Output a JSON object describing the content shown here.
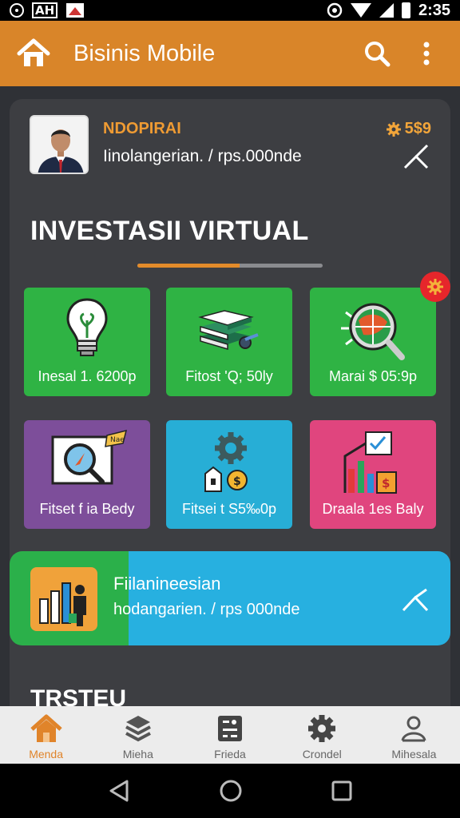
{
  "status_bar": {
    "box_text": "AH",
    "time": "2:35"
  },
  "app_bar": {
    "title": "Bisinis Mobile",
    "home_icon": "home-icon",
    "search_icon": "search-icon",
    "menu_icon": "more-vert-icon",
    "color": "#d98529"
  },
  "profile": {
    "name": "NDOPIRAI",
    "description": "Iinolangerian. / rps.000nde",
    "coins": "5$9"
  },
  "section": {
    "title": "INVESTASII VIRTUAL",
    "progress": 0.55
  },
  "tiles": [
    {
      "label": "Inesal 1. 6200p",
      "color": "#2fb344",
      "icon": "lightbulb-icon"
    },
    {
      "label": "Fitost 'Q; 50ly",
      "color": "#2fb344",
      "icon": "books-icon"
    },
    {
      "label": "Marai $ 05:9p",
      "color": "#2fb344",
      "icon": "globe-magnifier-icon"
    },
    {
      "label": "Fitset f ia Bedy",
      "color": "#7d4e9a",
      "icon": "screen-search-icon",
      "tag": "Nae"
    },
    {
      "label": "Fitsei t S5‰0p",
      "color": "#27aed6",
      "icon": "gear-money-icon"
    },
    {
      "label": "Draala 1es Baly",
      "color": "#e0457e",
      "icon": "chart-money-icon"
    }
  ],
  "banner": {
    "title": "Fiilanineesian",
    "description": "hodangarien. / rps 000nde"
  },
  "sub_section": {
    "title": "TRSTEU"
  },
  "bottom_nav": [
    {
      "label": "Menda",
      "icon": "home-icon",
      "active": true
    },
    {
      "label": "Mieha",
      "icon": "layers-icon",
      "active": false
    },
    {
      "label": "Frieda",
      "icon": "tools-icon",
      "active": false
    },
    {
      "label": "Crondel",
      "icon": "gear-icon",
      "active": false
    },
    {
      "label": "Mihesala",
      "icon": "user-icon",
      "active": false
    }
  ]
}
